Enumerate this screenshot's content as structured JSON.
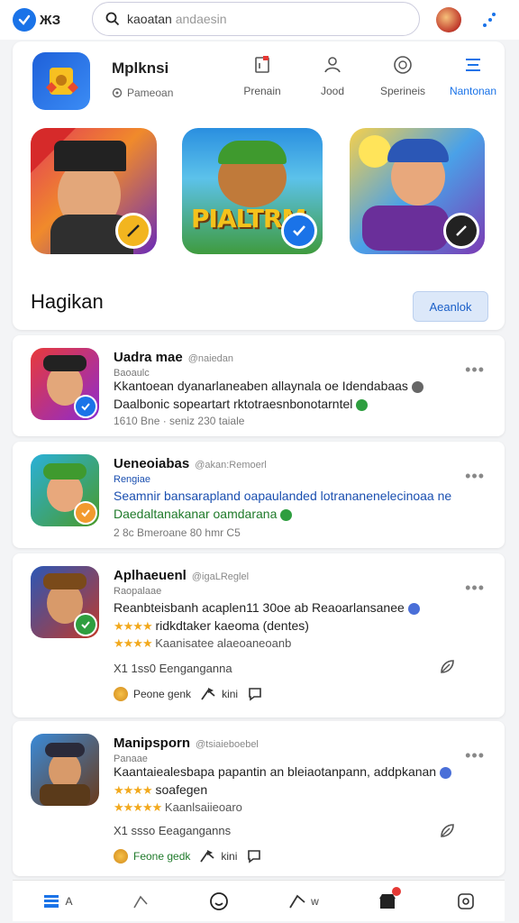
{
  "topbar": {
    "brand": "ЖЗ",
    "search_value": "kaoatan",
    "search_placeholder": "andaesin"
  },
  "header": {
    "app_name": "Mplknsi",
    "app_sub": "Pameoan",
    "tabs": [
      {
        "label": "Prenain",
        "icon": "save-icon",
        "active": false
      },
      {
        "label": "Jood",
        "icon": "person-icon",
        "active": false
      },
      {
        "label": "Sperineis",
        "icon": "clock-icon",
        "active": false
      },
      {
        "label": "Nantonan",
        "icon": "menu-icon",
        "active": true
      }
    ],
    "featured": [
      {
        "name": "game-1"
      },
      {
        "name": "game-2",
        "overlay_text": "PIALTRM"
      },
      {
        "name": "game-3"
      }
    ],
    "section_title": "Hagikan",
    "section_button": "Aeanlok"
  },
  "list": [
    {
      "title": "Uadra mae",
      "handle": "@naiedan",
      "sub": "Baoaulc",
      "line1": "Kkantoean dyanarlaneaben allaynala oe Idendabaas",
      "line2": "Daalbonic sopeartart rktotraesnbonotarntel",
      "meta": "1610 Bne · seniz 230 taiale",
      "check_color": "#1a73e8"
    },
    {
      "title": "Ueneoiabas",
      "handle": "@akan:Remoerl",
      "sub": "Rengiae",
      "line1": "Seamnir bansarapland oapaulanded lotrananenelecinoaa ne",
      "line2": "Daedaltanakanar oamdarana",
      "meta": "2 8c Bmeroane 80 hmr C5",
      "check_color": "#f29a2e"
    },
    {
      "title": "Aplhaeuenl",
      "handle": "@igaLReglel",
      "sub": "Raopalaae",
      "line1": "Reanbteisbanh acaplen11 30oe ab Reaoarlansanee",
      "line2": "ridkdtaker kaeoma (dentes)",
      "line3": "Kaanisatee alaeoaneoanb",
      "meta": "X1 1ss0 Eenganganna",
      "action1": "Peone genk",
      "action2": "kini",
      "check_color": "#2e9e3f"
    },
    {
      "title": "Manipsporn",
      "handle": "@tsiaieboebel",
      "sub": "Panaae",
      "line1": "Kaantaiealesbapa papantin an bleiaotanpann, addpkanan",
      "line2": "soafegen",
      "line3": "Kaanlsaiieoaro",
      "meta": "X1 ssso Eeaganganns",
      "action1": "Feone gedk",
      "action2": "kini"
    }
  ],
  "bottom_nav": [
    {
      "label": "A",
      "icon": "library-icon"
    },
    {
      "label": "",
      "icon": "share-icon"
    },
    {
      "label": "",
      "icon": "smile-icon"
    },
    {
      "label": "w",
      "icon": "send-icon"
    },
    {
      "label": "",
      "icon": "store-icon",
      "badge": true
    },
    {
      "label": "",
      "icon": "settings-icon"
    }
  ],
  "colors": {
    "accent": "#1a73e8",
    "brand_badge": "#1a73e8",
    "star": "#f2a91d",
    "notification": "#e53935"
  }
}
